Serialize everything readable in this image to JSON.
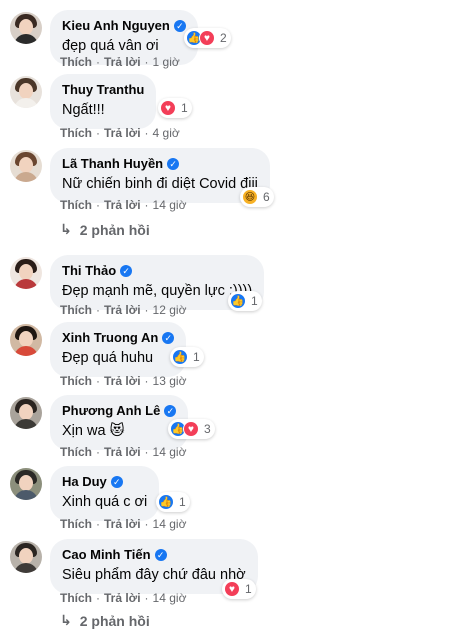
{
  "comments": [
    {
      "name": "Kieu Anh Nguyen",
      "text": "đẹp quá vân ơi",
      "time": "1 giờ",
      "reactions": [
        "like",
        "love"
      ],
      "reaction_count": "2"
    },
    {
      "name": "Thuy Tranthu",
      "text": "Ngất!!!",
      "time": "4 giờ",
      "reactions": [
        "love"
      ],
      "reaction_count": "1"
    },
    {
      "name": "Lã Thanh Huyền",
      "text": "Nữ chiến binh đi diệt Covid điii",
      "time": "14 giờ",
      "reactions": [
        "haha"
      ],
      "reaction_count": "6"
    },
    {
      "name": "Thi Thảo",
      "text": "Đẹp mạnh mẽ, quyền lực :))))",
      "time": "12 giờ",
      "reactions": [
        "like"
      ],
      "reaction_count": "1"
    },
    {
      "name": "Xinh Truong An",
      "text": "Đẹp quá huhu",
      "time": "13 giờ",
      "reactions": [
        "like"
      ],
      "reaction_count": "1"
    },
    {
      "name": "Phương Anh Lê",
      "text": "Xịn wa 😻",
      "time": "14 giờ",
      "reactions": [
        "like",
        "love"
      ],
      "reaction_count": "3"
    },
    {
      "name": "Ha Duy",
      "text": "Xinh quá c ơi",
      "time": "14 giờ",
      "reactions": [
        "like"
      ],
      "reaction_count": "1"
    },
    {
      "name": "Cao Minh Tiến",
      "text": "Siêu phẩm đây chứ đâu nhờ",
      "time": "14 giờ",
      "reactions": [
        "love"
      ],
      "reaction_count": "1"
    }
  ],
  "actions": {
    "like": "Thích",
    "reply": "Trả lời",
    "dot": "·"
  },
  "reply_links": {
    "huyen": "2 phản hồi",
    "tien": "2 phản hồi"
  },
  "icons": {
    "like": "like-icon",
    "love": "love-icon",
    "haha": "haha-icon",
    "verified": "verified-badge-icon",
    "reply_arrow": "reply-arrow-icon"
  },
  "colors": {
    "like": "#1877f2",
    "love": "#f33e58",
    "haha": "#f7b125",
    "bubble": "#f0f2f5",
    "meta": "#65676b"
  }
}
